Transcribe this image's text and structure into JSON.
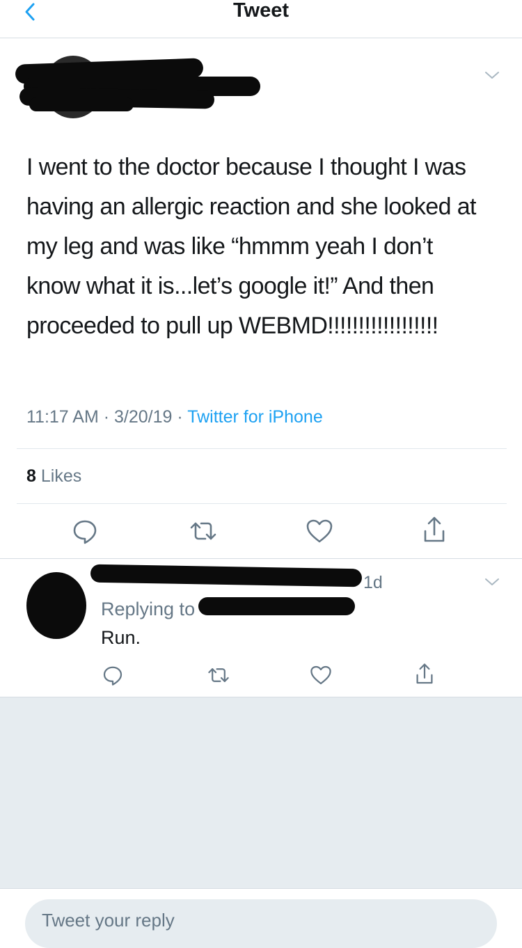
{
  "header": {
    "title": "Tweet",
    "back_icon": "chevron-left-icon",
    "accent": "#1da1f2"
  },
  "tweet": {
    "text": "I went to the doctor because I thought I was having an allergic reaction and she looked at my leg and was like “hmmm yeah I don’t know what it is...let’s google it!” And then proceeded to pull up WEBMD!!!!!!!!!!!!!!!!!!",
    "time": "11:17 AM",
    "separator": " · ",
    "date": "3/20/19",
    "source": "Twitter for iPhone",
    "likes_count": "8",
    "likes_label": "Likes",
    "menu_icon": "chevron-down-icon",
    "actions": [
      "reply-icon",
      "retweet-icon",
      "like-icon",
      "share-icon"
    ]
  },
  "reply": {
    "time": "1d",
    "replying_to": "Replying to",
    "text": "Run.",
    "menu_icon": "chevron-down-icon",
    "actions": [
      "reply-icon",
      "retweet-icon",
      "like-icon",
      "share-icon"
    ]
  },
  "composer": {
    "placeholder": "Tweet your reply"
  },
  "colors": {
    "text": "#14171a",
    "secondary": "#657786",
    "link": "#1da1f2",
    "background": "#e6ecf0"
  }
}
